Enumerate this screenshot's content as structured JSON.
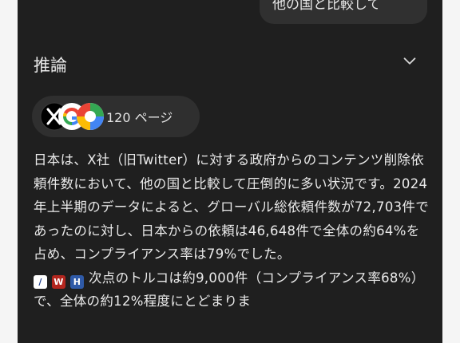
{
  "user_message": "他の国と比較して",
  "reasoning": {
    "label": "推論"
  },
  "sources": {
    "pages_label": "120 ページ"
  },
  "answer": {
    "text_1": "日本は、X社（旧Twitter）に対する政府からのコンテンツ削除依頼件数において、他の国と比較して圧倒的に多い状況です。2024年上半期のデータによると、グローバル総依頼件数が72,703件であったのに対し、日本からの依頼は46,648件で全体の約64%を占め、コンプライアンス率は79%でした。",
    "text_2": "次点のトルコは約9,000件（コンプライアンス率68%）で、全体の約12%程度にとどまりま"
  },
  "colors": {
    "background": "#1f1f1f",
    "bubble": "#303030",
    "pill": "#2f2f2f",
    "text": "#eaeaea"
  },
  "icons": [
    "x-logo-icon",
    "google-logo-icon",
    "chevron-down-icon"
  ]
}
